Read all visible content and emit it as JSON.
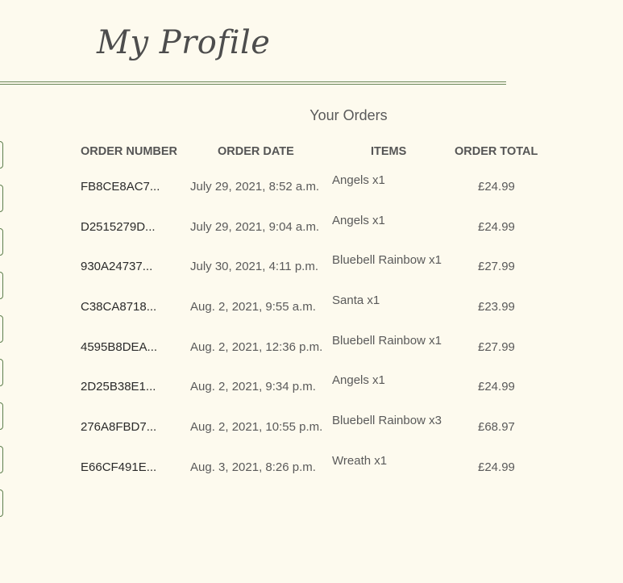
{
  "header": {
    "title": "My Profile"
  },
  "orders": {
    "heading": "Your Orders",
    "columns": {
      "order_number": "ORDER NUMBER",
      "order_date": "ORDER DATE",
      "items": "ITEMS",
      "order_total": "ORDER TOTAL"
    },
    "rows": [
      {
        "number": "FB8CE8AC7...",
        "date": "July 29, 2021, 8:52 a.m.",
        "items": "Angels x1",
        "total": "£24.99"
      },
      {
        "number": "D2515279D...",
        "date": "July 29, 2021, 9:04 a.m.",
        "items": "Angels x1",
        "total": "£24.99"
      },
      {
        "number": "930A24737...",
        "date": "July 30, 2021, 4:11 p.m.",
        "items": "Bluebell Rainbow x1",
        "total": "£27.99"
      },
      {
        "number": "C38CA8718...",
        "date": "Aug. 2, 2021, 9:55 a.m.",
        "items": "Santa x1",
        "total": "£23.99"
      },
      {
        "number": "4595B8DEA...",
        "date": "Aug. 2, 2021, 12:36 p.m.",
        "items": "Bluebell Rainbow x1",
        "total": "£27.99"
      },
      {
        "number": "2D25B38E1...",
        "date": "Aug. 2, 2021, 9:34 p.m.",
        "items": "Angels x1",
        "total": "£24.99"
      },
      {
        "number": "276A8FBD7...",
        "date": "Aug. 2, 2021, 10:55 p.m.",
        "items": "Bluebell Rainbow x3",
        "total": "£68.97"
      },
      {
        "number": "E66CF491E...",
        "date": "Aug. 3, 2021, 8:26 p.m.",
        "items": "Wreath x1",
        "total": "£24.99"
      }
    ]
  },
  "colors": {
    "background": "#fdfaee",
    "accent_green": "#5e7f4e",
    "text": "#5a5a5a"
  }
}
